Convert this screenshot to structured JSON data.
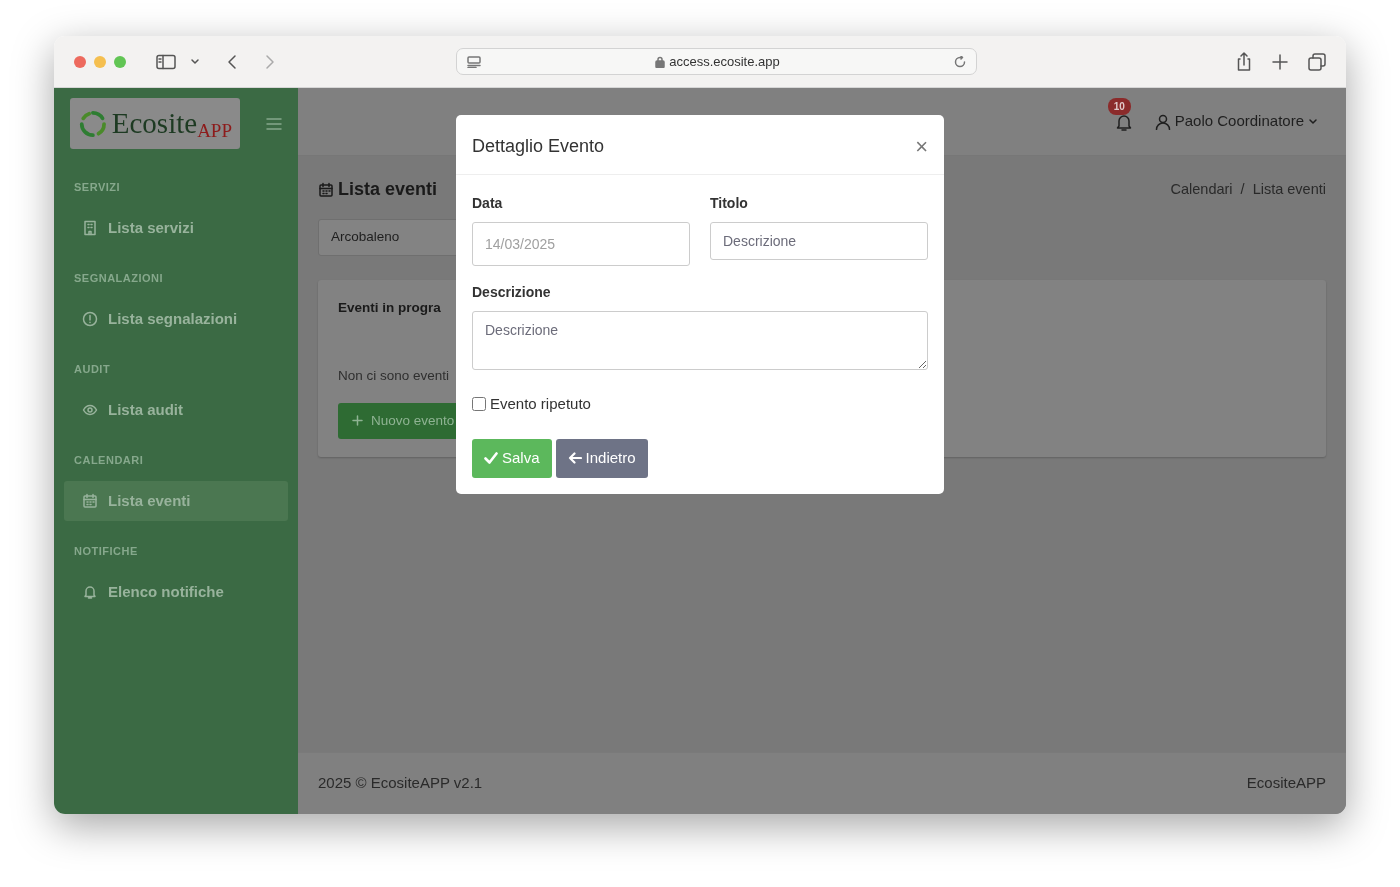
{
  "browser": {
    "url": "access.ecosite.app"
  },
  "sidebar": {
    "logo": {
      "text": "Ecosite",
      "sub": "APP"
    },
    "sections": [
      {
        "title": "SERVIZI",
        "items": [
          {
            "label": "Lista servizi",
            "selected": false
          }
        ]
      },
      {
        "title": "SEGNALAZIONI",
        "items": [
          {
            "label": "Lista segnalazioni",
            "selected": false
          }
        ]
      },
      {
        "title": "AUDIT",
        "items": [
          {
            "label": "Lista audit",
            "selected": false
          }
        ]
      },
      {
        "title": "CALENDARI",
        "items": [
          {
            "label": "Lista eventi",
            "selected": true
          }
        ]
      },
      {
        "title": "NOTIFICHE",
        "items": [
          {
            "label": "Elenco notifiche",
            "selected": false
          }
        ]
      }
    ]
  },
  "header": {
    "notification_count": "10",
    "user": "Paolo Coordinatore"
  },
  "page": {
    "title": "Lista eventi",
    "breadcrumb": [
      "Calendari",
      "Lista eventi"
    ],
    "breadcrumb_separator": "/",
    "select_value": "Arcobaleno",
    "card": {
      "title": "Eventi in progra",
      "empty_text": "Non ci sono eventi",
      "new_button": "Nuovo evento"
    }
  },
  "footer": {
    "left": "2025 © EcositeAPP v2.1",
    "right": "EcositeAPP"
  },
  "modal": {
    "title": "Dettaglio Evento",
    "close": "×",
    "date_label": "Data",
    "date_value": "14/03/2025",
    "title_label": "Titolo",
    "title_placeholder": "Descrizione",
    "description_label": "Descrizione",
    "description_placeholder": "Descrizione",
    "repeat": {
      "label": "Evento ripetuto",
      "checked": false
    },
    "buttons": [
      {
        "label": "Salva",
        "kind": "save"
      },
      {
        "label": "Indietro",
        "kind": "back"
      }
    ]
  }
}
